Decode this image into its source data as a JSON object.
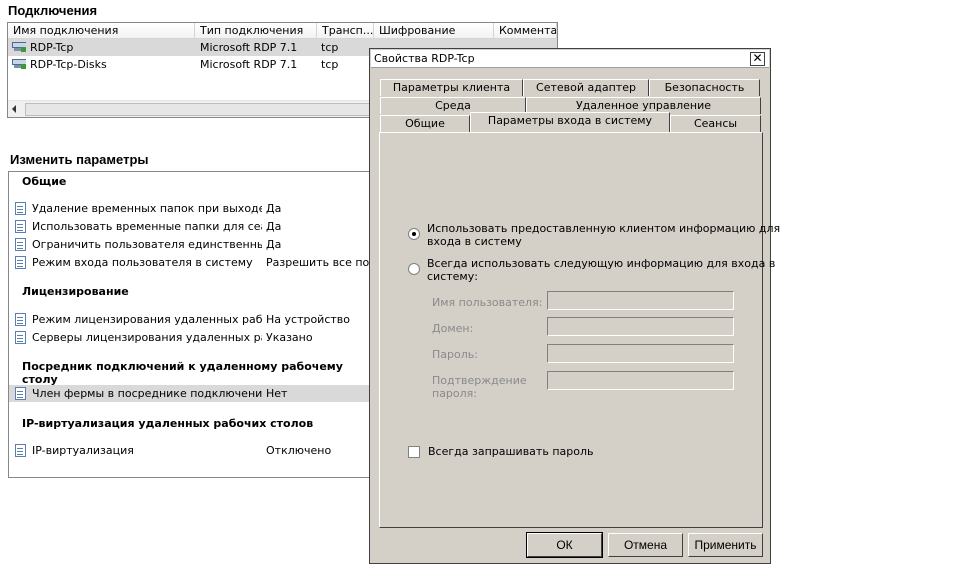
{
  "connections": {
    "title": "Подключения",
    "columns": [
      "Имя подключения",
      "Тип подключения",
      "Трансп...",
      "Шифрование",
      "Комментар"
    ],
    "rows": [
      {
        "name": "RDP-Tcp",
        "type": "Microsoft RDP 7.1",
        "transport": "tcp",
        "encryption": "",
        "comment": ""
      },
      {
        "name": "RDP-Tcp-Disks",
        "type": "Microsoft RDP 7.1",
        "transport": "tcp",
        "encryption": "",
        "comment": ""
      }
    ]
  },
  "settings": {
    "title": "Изменить параметры",
    "groups": [
      {
        "title": "Общие",
        "items": [
          {
            "label": "Удаление временных папок при выходе",
            "value": "Да"
          },
          {
            "label": "Использовать временные папки для сеан...",
            "value": "Да"
          },
          {
            "label": "Ограничить пользователя единственным ...",
            "value": "Да"
          },
          {
            "label": "Режим входа пользователя в систему",
            "value": "Разрешить все подк"
          }
        ]
      },
      {
        "title": "Лицензирование",
        "items": [
          {
            "label": "Режим лицензирования удаленных рабочи...",
            "value": "На устройство"
          },
          {
            "label": "Серверы лицензирования удаленных рабо...",
            "value": "Указано"
          }
        ]
      },
      {
        "title": "Посредник подключений к удаленному рабочему столу",
        "items": [
          {
            "label": "Член фермы в посреднике подключений к...",
            "value": "Нет"
          }
        ]
      },
      {
        "title": "IP-виртуализация удаленных рабочих столов",
        "items": [
          {
            "label": "IP-виртуализация",
            "value": "Отключено"
          }
        ]
      }
    ]
  },
  "dialog": {
    "title": "Свойства RDP-Tcp",
    "close": "✕",
    "tabs_row1": [
      "Параметры клиента",
      "Сетевой адаптер",
      "Безопасность"
    ],
    "tabs_row2": [
      "Среда",
      "Удаленное управление"
    ],
    "tabs_row3": [
      "Общие",
      "Параметры входа в систему",
      "Сеансы"
    ],
    "active_tab": "Параметры входа в систему",
    "radio_client_line1": "Использовать предоставленную клиентом информацию для",
    "radio_client_line2": "входа в систему",
    "radio_always_line1": "Всегда использовать следующую информацию для входа в",
    "radio_always_line2": "систему:",
    "username_label": "Имя пользователя:",
    "domain_label": "Домен:",
    "password_label": "Пароль:",
    "confirm_label_line1": "Подтверждение",
    "confirm_label_line2": "пароля:",
    "always_prompt_label": "Всегда запрашивать пароль",
    "selected_option": "client",
    "buttons": {
      "ok": "ОК",
      "cancel": "Отмена",
      "apply": "Применить"
    }
  }
}
